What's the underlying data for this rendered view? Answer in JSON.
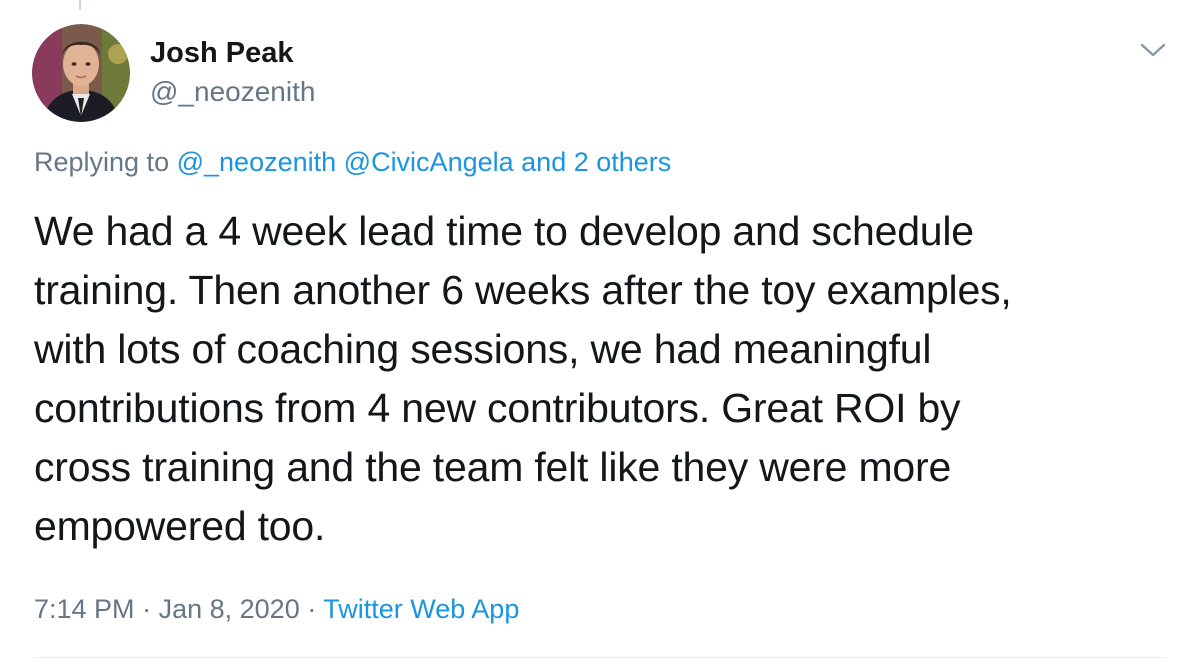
{
  "author": {
    "display_name": "Josh Peak",
    "handle": "@_neozenith"
  },
  "menu": {
    "icon": "chevron-down-icon"
  },
  "reply_context": {
    "prefix": "Replying to",
    "mentions": [
      "@_neozenith",
      "@CivicAngela"
    ],
    "others": "and 2 others"
  },
  "tweet": {
    "lines": [
      "We had a 4 week lead time to develop and schedule",
      "training. Then another 6 weeks after the toy examples,",
      "with lots of coaching sessions, we had meaningful",
      "contributions from 4 new contributors. Great ROI by",
      "cross training and the team felt like they were more",
      "empowered too."
    ]
  },
  "meta": {
    "time": "7:14 PM",
    "separator": "·",
    "date": "Jan 8, 2020",
    "source": "Twitter Web App"
  },
  "colors": {
    "link": "#1b95e0",
    "secondary_text": "#657786",
    "primary_text": "#14171a"
  }
}
